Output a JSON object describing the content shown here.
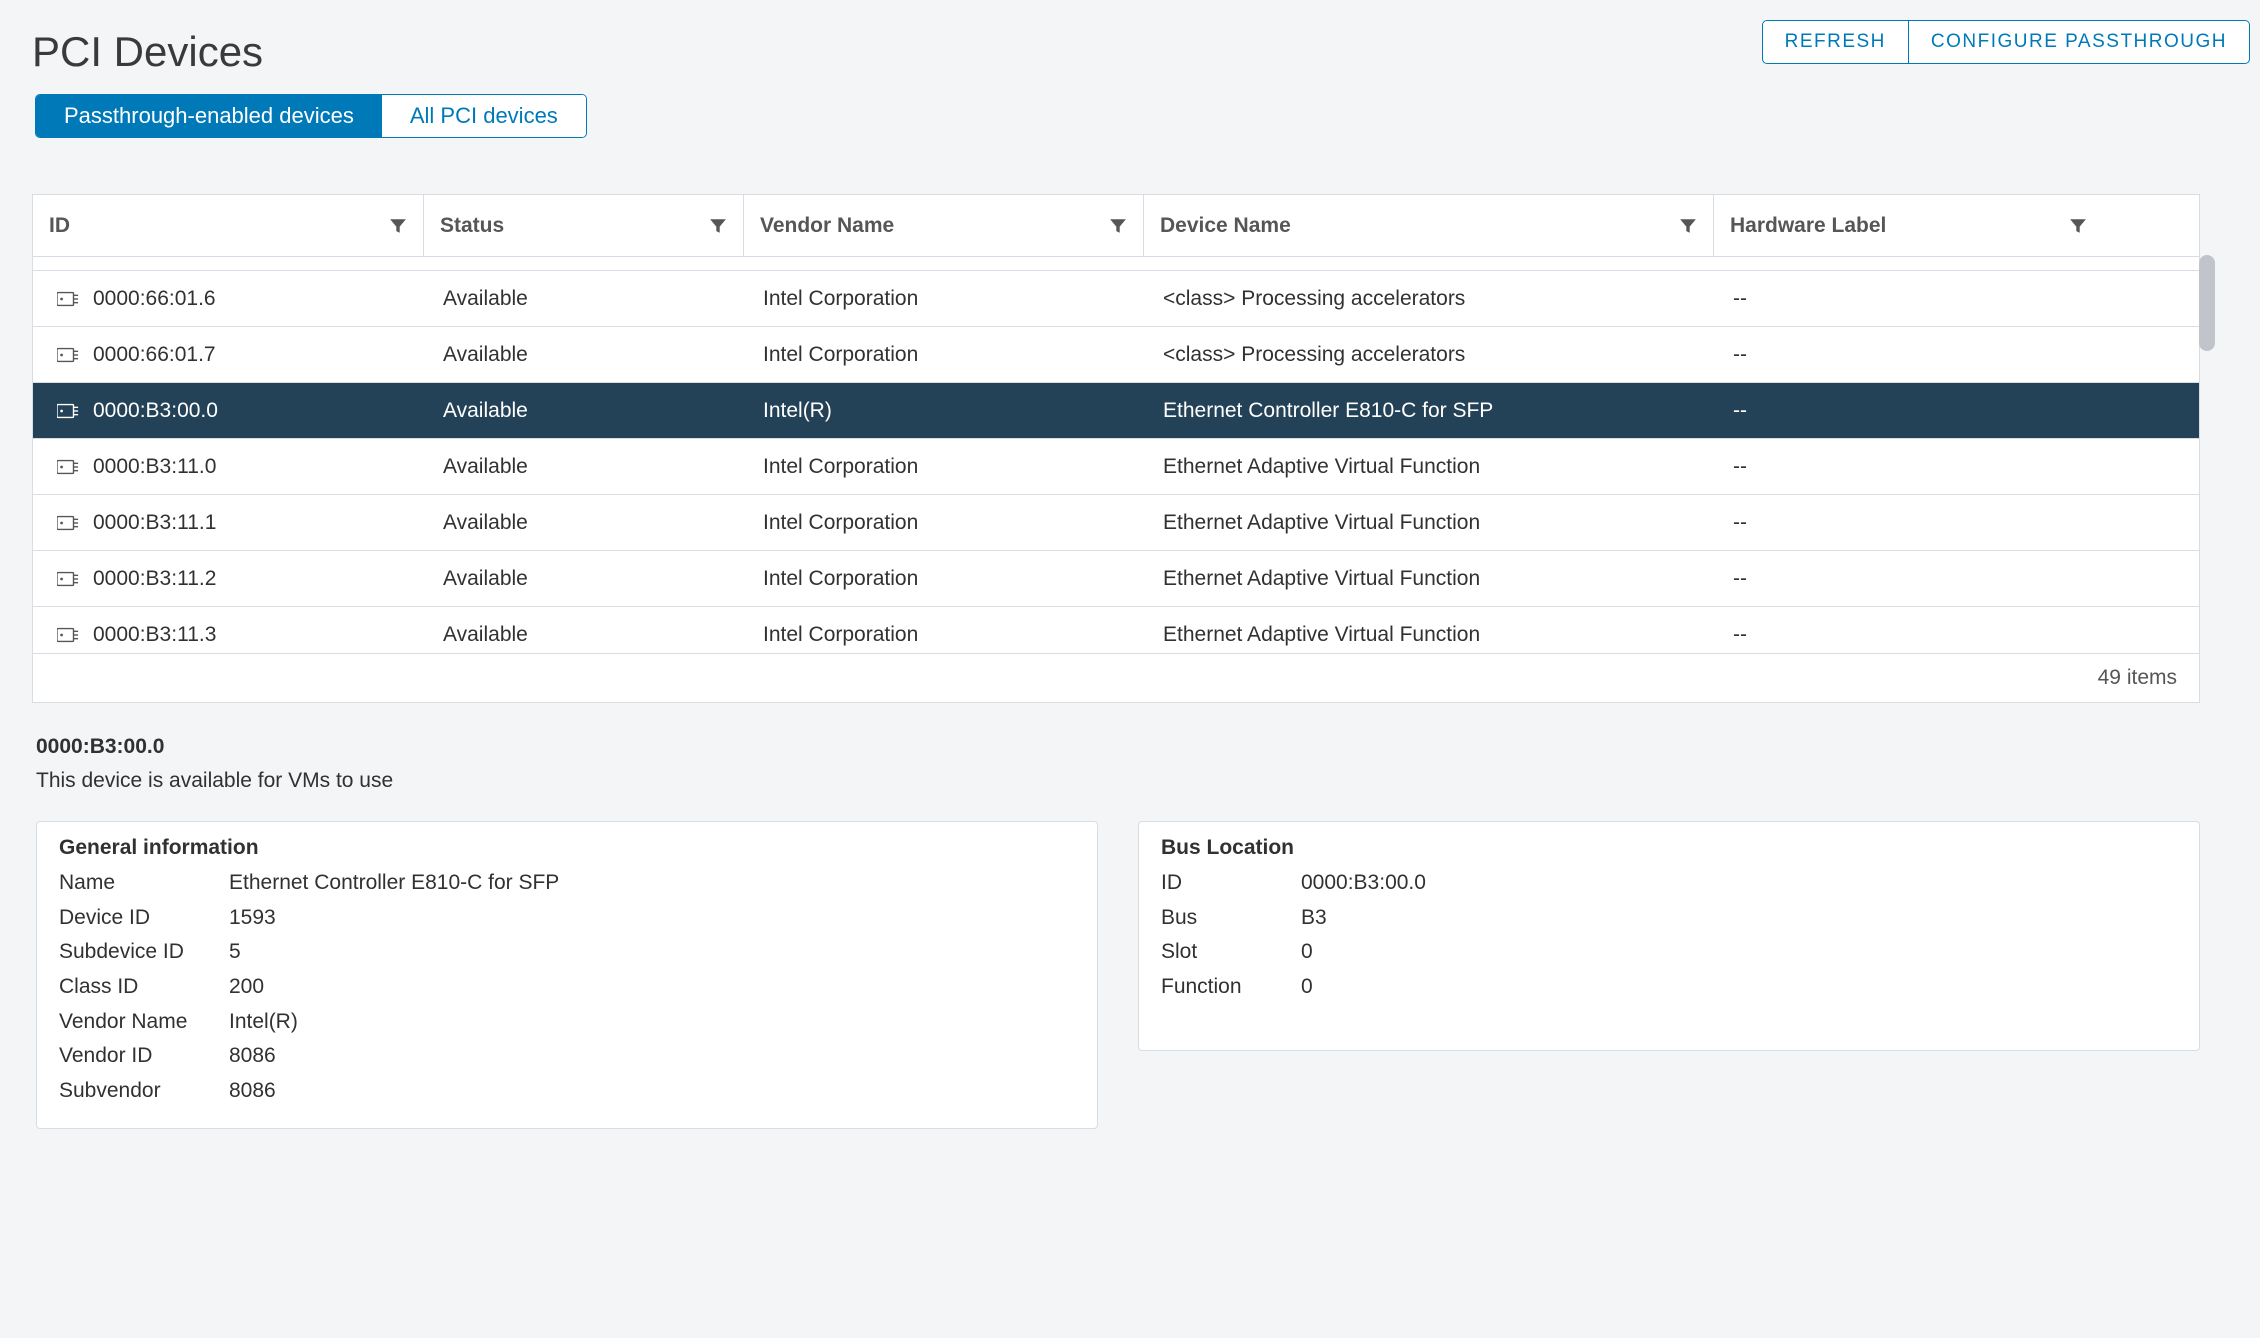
{
  "title": "PCI Devices",
  "header_buttons": {
    "refresh": "REFRESH",
    "configure": "CONFIGURE PASSTHROUGH"
  },
  "tabs": {
    "passthrough": "Passthrough-enabled devices",
    "all": "All PCI devices"
  },
  "columns": {
    "id": "ID",
    "status": "Status",
    "vendor": "Vendor Name",
    "device": "Device Name",
    "hw": "Hardware Label"
  },
  "rows": [
    {
      "id": "0000:66:01.6",
      "status": "Available",
      "vendor": "Intel Corporation",
      "device": "<class> Processing accelerators",
      "hw": "--"
    },
    {
      "id": "0000:66:01.7",
      "status": "Available",
      "vendor": "Intel Corporation",
      "device": "<class> Processing accelerators",
      "hw": "--"
    },
    {
      "id": "0000:B3:00.0",
      "status": "Available",
      "vendor": "Intel(R)",
      "device": "Ethernet Controller E810-C for SFP",
      "hw": "--"
    },
    {
      "id": "0000:B3:11.0",
      "status": "Available",
      "vendor": "Intel Corporation",
      "device": "Ethernet Adaptive Virtual Function",
      "hw": "--"
    },
    {
      "id": "0000:B3:11.1",
      "status": "Available",
      "vendor": "Intel Corporation",
      "device": "Ethernet Adaptive Virtual Function",
      "hw": "--"
    },
    {
      "id": "0000:B3:11.2",
      "status": "Available",
      "vendor": "Intel Corporation",
      "device": "Ethernet Adaptive Virtual Function",
      "hw": "--"
    },
    {
      "id": "0000:B3:11.3",
      "status": "Available",
      "vendor": "Intel Corporation",
      "device": "Ethernet Adaptive Virtual Function",
      "hw": "--"
    }
  ],
  "footer": "49 items",
  "detail": {
    "id": "0000:B3:00.0",
    "subtitle": "This device is available for VMs to use",
    "general_heading": "General information",
    "bus_heading": "Bus Location",
    "labels": {
      "name": "Name",
      "device_id": "Device ID",
      "subdevice_id": "Subdevice ID",
      "class_id": "Class ID",
      "vendor_name": "Vendor Name",
      "vendor_id": "Vendor ID",
      "subvendor": "Subvendor",
      "bus_id": "ID",
      "bus": "Bus",
      "slot": "Slot",
      "func": "Function"
    },
    "values": {
      "name": "Ethernet Controller E810-C for SFP",
      "device_id": "1593",
      "subdevice_id": "5",
      "class_id": "200",
      "vendor_name": "Intel(R)",
      "vendor_id": "8086",
      "subvendor": "8086",
      "bus_id": "0000:B3:00.0",
      "bus": "B3",
      "slot": "0",
      "func": "0"
    }
  }
}
